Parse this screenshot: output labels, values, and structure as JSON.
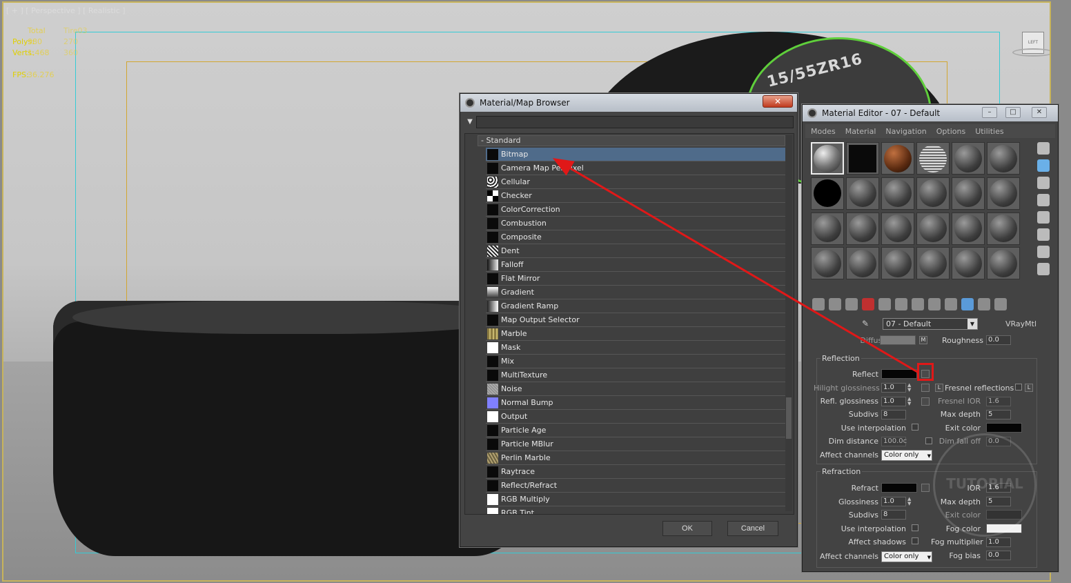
{
  "viewport": {
    "label": "[ + ] [ Perspective ] [ Realistic ]",
    "stats": {
      "header": [
        "Total",
        "Tire03"
      ],
      "polys": [
        "Polys:",
        "980",
        "270"
      ],
      "verts": [
        "Verts:",
        "1,468",
        "360"
      ],
      "fps": [
        "FPS:",
        "36.276"
      ]
    },
    "viewcube_label": "LEFT",
    "tire_sidewall_text": "15/55ZR16"
  },
  "browser": {
    "title": "Material/Map Browser",
    "close_label": "✕",
    "search_value": "",
    "group_label": "- Standard",
    "items": [
      {
        "label": "Bitmap",
        "swatch": "#0a0a0a",
        "selected": true
      },
      {
        "label": "Camera Map Per Pixel",
        "swatch": "#0a0a0a"
      },
      {
        "label": "Cellular",
        "swatch": "cellular"
      },
      {
        "label": "Checker",
        "swatch": "checker"
      },
      {
        "label": "ColorCorrection",
        "swatch": "#0a0a0a"
      },
      {
        "label": "Combustion",
        "swatch": "#0a0a0a"
      },
      {
        "label": "Composite",
        "swatch": "#0a0a0a"
      },
      {
        "label": "Dent",
        "swatch": "dent"
      },
      {
        "label": "Falloff",
        "swatch": "falloff"
      },
      {
        "label": "Flat Mirror",
        "swatch": "#0a0a0a"
      },
      {
        "label": "Gradient",
        "swatch": "gradient"
      },
      {
        "label": "Gradient Ramp",
        "swatch": "gradient-ramp"
      },
      {
        "label": "Map Output Selector",
        "swatch": "#0a0a0a"
      },
      {
        "label": "Marble",
        "swatch": "marble"
      },
      {
        "label": "Mask",
        "swatch": "#ffffff"
      },
      {
        "label": "Mix",
        "swatch": "#0a0a0a"
      },
      {
        "label": "MultiTexture",
        "swatch": "#0a0a0a"
      },
      {
        "label": "Noise",
        "swatch": "noise"
      },
      {
        "label": "Normal Bump",
        "swatch": "#8080ff"
      },
      {
        "label": "Output",
        "swatch": "#ffffff"
      },
      {
        "label": "Particle Age",
        "swatch": "#0a0a0a"
      },
      {
        "label": "Particle MBlur",
        "swatch": "#0a0a0a"
      },
      {
        "label": "Perlin Marble",
        "swatch": "perlin"
      },
      {
        "label": "Raytrace",
        "swatch": "#0a0a0a"
      },
      {
        "label": "Reflect/Refract",
        "swatch": "#0a0a0a"
      },
      {
        "label": "RGB Multiply",
        "swatch": "#ffffff"
      },
      {
        "label": "RGB Tint",
        "swatch": "#ffffff"
      }
    ],
    "ok_label": "OK",
    "cancel_label": "Cancel"
  },
  "editor": {
    "title": "Material Editor - 07 - Default",
    "menu": [
      "Modes",
      "Material",
      "Navigation",
      "Options",
      "Utilities"
    ],
    "material_name": "07 - Default",
    "material_type": "VRayMtl",
    "diffuse": {
      "label": "Diffuse",
      "map_btn": "M",
      "roughness_label": "Roughness",
      "roughness": "0.0"
    },
    "reflection": {
      "title": "Reflection",
      "reflect_label": "Reflect",
      "hilight_label": "Hilight glossiness",
      "hilight": "1.0",
      "lock_btn": "L",
      "fresnel_label": "Fresnel reflections",
      "fresnel_lock": "L",
      "refl_gloss_label": "Refl. glossiness",
      "refl_gloss": "1.0",
      "fresnel_ior_label": "Fresnel IOR",
      "fresnel_ior": "1.6",
      "subdivs_label": "Subdivs",
      "subdivs": "8",
      "max_depth_label": "Max depth",
      "max_depth": "5",
      "use_interp_label": "Use interpolation",
      "exit_color_label": "Exit color",
      "dim_distance_label": "Dim distance",
      "dim_distance": "100.0c",
      "dim_falloff_label": "Dim fall off",
      "dim_falloff": "0.0",
      "affect_channels_label": "Affect channels",
      "affect_channels": "Color only"
    },
    "refraction": {
      "title": "Refraction",
      "refract_label": "Refract",
      "ior_label": "IOR",
      "ior": "1.6",
      "gloss_label": "Glossiness",
      "gloss": "1.0",
      "max_depth_label": "Max depth",
      "max_depth": "5",
      "subdivs_label": "Subdivs",
      "subdivs": "8",
      "exit_color_label": "Exit color",
      "use_interp_label": "Use interpolation",
      "fog_color_label": "Fog color",
      "affect_shadows_label": "Affect shadows",
      "fog_mult_label": "Fog multiplier",
      "fog_mult": "1.0",
      "affect_channels_label": "Affect channels",
      "affect_channels": "Color only",
      "fog_bias_label": "Fog bias",
      "fog_bias": "0.0"
    }
  },
  "annotation": {
    "arrow_color": "#e01818"
  },
  "watermark_text": "TUTORIAL"
}
